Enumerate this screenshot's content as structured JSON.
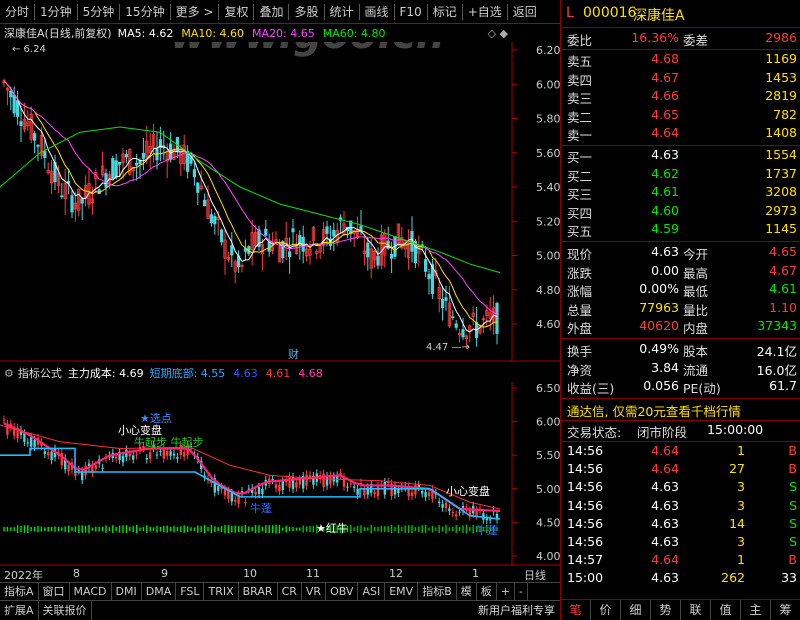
{
  "topbar": {
    "items": [
      "分时",
      "1分钟",
      "5分钟",
      "15分钟",
      "更多 >",
      "复权",
      "叠加",
      "多股",
      "统计",
      "画线",
      "F10",
      "标记",
      "+自选",
      "返回"
    ]
  },
  "watermark": "www.goo.cn",
  "title": {
    "name": "深康佳A(日线,前复权)",
    "ma5": "MA5: 4.62",
    "ma10": "MA10: 4.60",
    "ma20": "MA20: 4.65",
    "ma60": "MA60: 4.80",
    "high_mark": "6.24",
    "low_mark": "4.47",
    "cai": "财"
  },
  "main_axis": [
    "6.20",
    "6.00",
    "5.80",
    "5.60",
    "5.40",
    "5.20",
    "5.00",
    "4.80",
    "4.60"
  ],
  "indicator": {
    "name": "指标公式",
    "main_cost": "主力成本: 4.69",
    "short_bottom": "短期底部: 4.55",
    "v1": "4.63",
    "v2": "4.61",
    "v3": "4.68",
    "ann_xuan": "★选点",
    "ann_xiaoxin1": "小心变盘",
    "ann_qibu": "牛起步 牛起步",
    "ann_xiaoxin2": "小心变盘",
    "ann_hongniu": "★红牛",
    "ann_niupeng": "牛蓬",
    "ann_niupeng2": "牛蓬"
  },
  "sub_axis": [
    "6.50",
    "6.00",
    "5.50",
    "5.00",
    "4.50",
    "4.00"
  ],
  "dates": {
    "year": "2022年",
    "m8": "8",
    "m9": "9",
    "m10": "10",
    "m11": "11",
    "m12": "12",
    "m1": "1",
    "period": "日线"
  },
  "tabs": [
    "指标A",
    "窗口",
    "MACD",
    "DMI",
    "DMA",
    "FSL",
    "TRIX",
    "BRAR",
    "CR",
    "VR",
    "OBV",
    "ASI",
    "EMV",
    "指标B",
    "模",
    "板",
    "+",
    "-"
  ],
  "statusbar": [
    "扩展A",
    "关联报价"
  ],
  "quote": {
    "code": "000016",
    "name": "深康佳A",
    "weibi_label": "委比",
    "weibi": "16.36%",
    "weicha_label": "委差",
    "weicha": "2986",
    "asks": [
      {
        "label": "卖五",
        "price": "4.68",
        "vol": "1169"
      },
      {
        "label": "卖四",
        "price": "4.67",
        "vol": "1453"
      },
      {
        "label": "卖三",
        "price": "4.66",
        "vol": "2819"
      },
      {
        "label": "卖二",
        "price": "4.65",
        "vol": "782"
      },
      {
        "label": "卖一",
        "price": "4.64",
        "vol": "1408"
      }
    ],
    "bids": [
      {
        "label": "买一",
        "price": "4.63",
        "vol": "1554"
      },
      {
        "label": "买二",
        "price": "4.62",
        "vol": "1737"
      },
      {
        "label": "买三",
        "price": "4.61",
        "vol": "3208"
      },
      {
        "label": "买四",
        "price": "4.60",
        "vol": "2973"
      },
      {
        "label": "买五",
        "price": "4.59",
        "vol": "1145"
      }
    ],
    "stats": [
      {
        "l1": "现价",
        "v1": "4.63",
        "l2": "今开",
        "v2": "4.65"
      },
      {
        "l1": "涨跌",
        "v1": "0.00",
        "l2": "最高",
        "v2": "4.67"
      },
      {
        "l1": "涨幅",
        "v1": "0.00%",
        "l2": "最低",
        "v2": "4.61"
      },
      {
        "l1": "总量",
        "v1": "77963",
        "l2": "量比",
        "v2": "1.10"
      },
      {
        "l1": "外盘",
        "v1": "40620",
        "l2": "内盘",
        "v2": "37343"
      }
    ],
    "stats2": [
      {
        "l1": "换手",
        "v1": "0.49%",
        "l2": "股本",
        "v2": "24.1亿"
      },
      {
        "l1": "净资",
        "v1": "3.84",
        "l2": "流通",
        "v2": "16.0亿"
      },
      {
        "l1": "收益(三)",
        "v1": "0.056",
        "l2": "PE(动)",
        "v2": "61.7"
      }
    ],
    "promo": "通达信, 仅需20元查看千档行情",
    "trade_state_label": "交易状态:",
    "trade_state": "闭市阶段",
    "trade_time": "15:00:00",
    "ticks": [
      {
        "t": "14:56",
        "p": "4.64",
        "v": "1",
        "s": "B"
      },
      {
        "t": "14:56",
        "p": "4.64",
        "v": "27",
        "s": "B"
      },
      {
        "t": "14:56",
        "p": "4.63",
        "v": "3",
        "s": "S"
      },
      {
        "t": "14:56",
        "p": "4.63",
        "v": "3",
        "s": "S"
      },
      {
        "t": "14:56",
        "p": "4.63",
        "v": "14",
        "s": "S"
      },
      {
        "t": "14:56",
        "p": "4.63",
        "v": "3",
        "s": "S"
      },
      {
        "t": "14:57",
        "p": "4.64",
        "v": "1",
        "s": "B"
      },
      {
        "t": "15:00",
        "p": "4.63",
        "v": "262",
        "s": "33"
      }
    ],
    "bottom_tabs": [
      "笔",
      "价",
      "细",
      "势",
      "联",
      "值",
      "主",
      "筹"
    ],
    "promo2": "新用户福利专享"
  }
}
